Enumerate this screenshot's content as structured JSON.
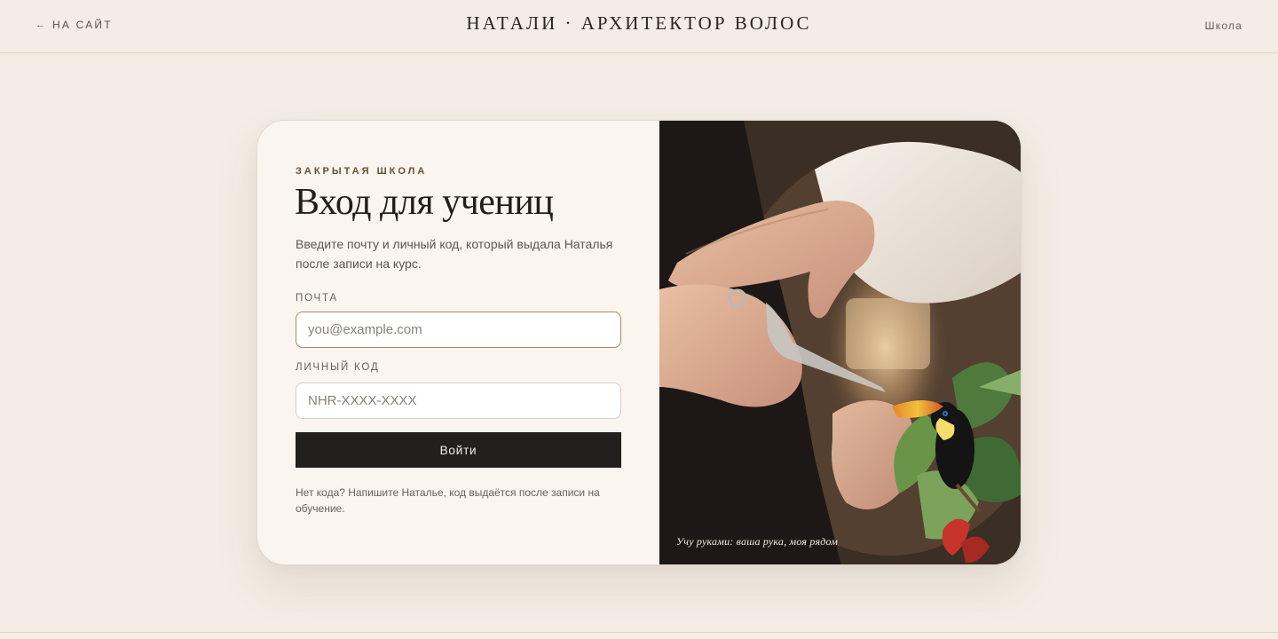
{
  "header": {
    "back_arrow": "←",
    "back_label": "НА САЙТ",
    "brand": "НАТАЛИ · АРХИТЕКТОР ВОЛОС",
    "school_link": "Школа"
  },
  "login": {
    "eyebrow": "ЗАКРЫТАЯ ШКОЛА",
    "title": "Вход для учениц",
    "subtitle": "Введите почту и личный код, который выдала Наталья после записи на курс.",
    "email_label": "ПОЧТА",
    "email_placeholder": "you@example.com",
    "email_value": "",
    "code_label": "ЛИЧНЫЙ КОД",
    "code_placeholder": "NHR-XXXX-XXXX",
    "code_value": "",
    "submit_label": "Войти",
    "help_text": "Нет кода? Напишите Наталье, код выдаётся после записи на обучение."
  },
  "photo": {
    "caption": "Учу руками: ваша рука, моя рядом",
    "icon": "toucan-illustration"
  },
  "colors": {
    "background": "#f4ede5",
    "card": "#faf5ef",
    "accent": "#a8895f",
    "button": "#231f1c",
    "eyebrow": "#6b4f33"
  }
}
